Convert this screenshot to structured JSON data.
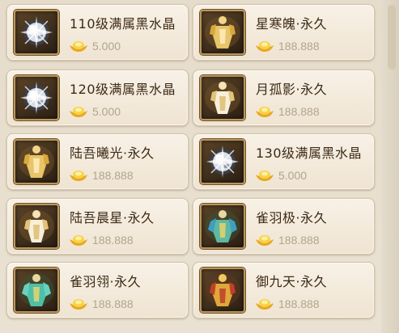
{
  "shop": {
    "items": [
      {
        "name": "110级满属黑水晶",
        "price": "5.000",
        "icon": "black-crystal-icon"
      },
      {
        "name": "星寒魄·永久",
        "price": "188.888",
        "icon": "golden-armor-icon"
      },
      {
        "name": "120级满属黑水晶",
        "price": "5.000",
        "icon": "black-crystal-icon"
      },
      {
        "name": "月孤影·永久",
        "price": "188.888",
        "icon": "white-gold-armor-icon"
      },
      {
        "name": "陆吾曦光·永久",
        "price": "188.888",
        "icon": "golden-armor-icon"
      },
      {
        "name": "130级满属黑水晶",
        "price": "5.000",
        "icon": "black-crystal-icon"
      },
      {
        "name": "陆吾晨星·永久",
        "price": "188.888",
        "icon": "white-gold-armor-icon"
      },
      {
        "name": "雀羽极·永久",
        "price": "188.888",
        "icon": "jade-armor-icon"
      },
      {
        "name": "雀羽翎·永久",
        "price": "188.888",
        "icon": "jade-armor-icon"
      },
      {
        "name": "御九天·永久",
        "price": "188.888",
        "icon": "red-gold-armor-icon"
      }
    ],
    "currency_icon": "gold-ingot-icon",
    "colors": {
      "card_bg": "#f5ede0",
      "name_text": "#3d2a16",
      "price_text": "#b3a58d",
      "frame_gold": "#b9965a",
      "ingot_gold": "#f2c230"
    }
  }
}
